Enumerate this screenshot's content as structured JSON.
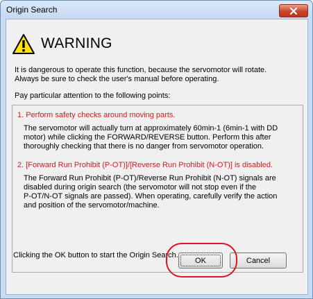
{
  "window": {
    "title": "Origin Search",
    "close_icon": "close-icon"
  },
  "warning": {
    "heading": "WARNING",
    "icon": "warning-triangle-icon",
    "intro": "It is dangerous to operate this function, because the servomotor will rotate.\nAlways be sure to check the user's manual before operating.",
    "attention": "Pay particular attention to the following points:"
  },
  "points": [
    {
      "heading": "1. Perform safety checks around moving parts.",
      "text": "The servomotor will actually turn at approximately 60min-1 (6min-1 with DD\nmotor) while clicking the FORWARD/REVERSE button. Perform this after\nthoroughly checking that there is no danger from servomotor operation."
    },
    {
      "heading": "2. [Forward Run Prohibit (P-OT)]/[Reverse Run Prohibit (N-OT)] is disabled.",
      "text": "The Forward Run Prohibit (P-OT)/Reverse Run Prohibit (N-OT) signals are\ndisabled during origin search (the servomotor will not stop even if the\nP-OT/N-OT signals are passed). When operating, carefully verify the action\nand position of the servomotor/machine."
    }
  ],
  "footer": {
    "instruction": "Clicking the OK button to start the Origin Search.",
    "ok_label": "OK",
    "cancel_label": "Cancel"
  },
  "colors": {
    "point_heading": "#e0151b",
    "highlight": "#e0151b"
  }
}
